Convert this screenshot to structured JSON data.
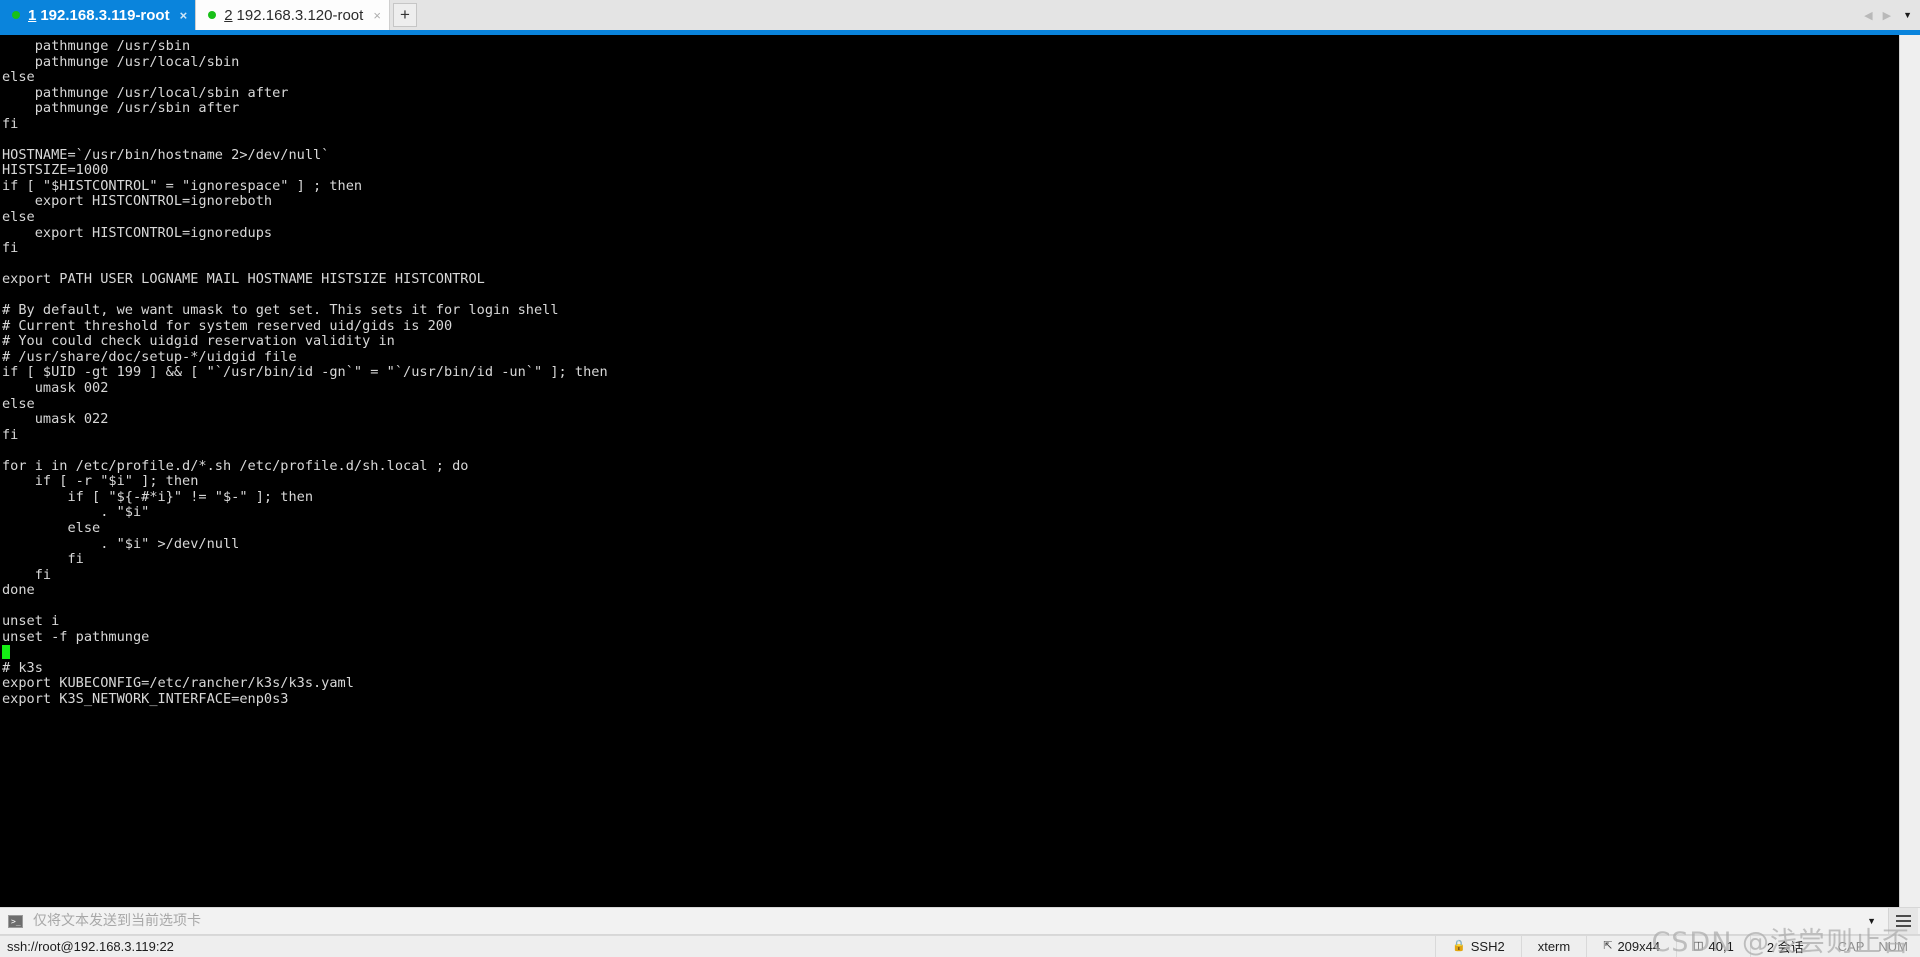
{
  "window": {
    "accent_color": "#0a84dc",
    "tab_active_bg": "#0a84dc",
    "terminal_bg": "#000000",
    "terminal_fg": "#d8d8d8",
    "cursor_color": "#14f014"
  },
  "tabbar": {
    "tabs": [
      {
        "number": "1",
        "label": "192.168.3.119-root",
        "close": "×",
        "status_dot": "connected-dot",
        "active": true
      },
      {
        "number": "2",
        "label": "192.168.3.120-root",
        "close": "×",
        "status_dot": "connected-dot",
        "active": false
      }
    ],
    "new_tab_label": "+",
    "prev_arrow": "◀",
    "next_arrow": "▶",
    "list_caret": "▼"
  },
  "terminal": {
    "lines": [
      "    pathmunge /usr/sbin",
      "    pathmunge /usr/local/sbin",
      "else",
      "    pathmunge /usr/local/sbin after",
      "    pathmunge /usr/sbin after",
      "fi",
      "",
      "HOSTNAME=`/usr/bin/hostname 2>/dev/null`",
      "HISTSIZE=1000",
      "if [ \"$HISTCONTROL\" = \"ignorespace\" ] ; then",
      "    export HISTCONTROL=ignoreboth",
      "else",
      "    export HISTCONTROL=ignoredups",
      "fi",
      "",
      "export PATH USER LOGNAME MAIL HOSTNAME HISTSIZE HISTCONTROL",
      "",
      "# By default, we want umask to get set. This sets it for login shell",
      "# Current threshold for system reserved uid/gids is 200",
      "# You could check uidgid reservation validity in",
      "# /usr/share/doc/setup-*/uidgid file",
      "if [ $UID -gt 199 ] && [ \"`/usr/bin/id -gn`\" = \"`/usr/bin/id -un`\" ]; then",
      "    umask 002",
      "else",
      "    umask 022",
      "fi",
      "",
      "for i in /etc/profile.d/*.sh /etc/profile.d/sh.local ; do",
      "    if [ -r \"$i\" ]; then",
      "        if [ \"${-#*i}\" != \"$-\" ]; then",
      "            . \"$i\"",
      "        else",
      "            . \"$i\" >/dev/null",
      "        fi",
      "    fi",
      "done",
      "",
      "unset i",
      "unset -f pathmunge"
    ],
    "cursor_line": "",
    "trailing_lines": [
      "# k3s",
      "export KUBECONFIG=/etc/rancher/k3s/k3s.yaml",
      "export K3S_NETWORK_INTERFACE=enp0s3"
    ]
  },
  "commandbar": {
    "icon": "terminal-prompt-icon",
    "icon_glyph": ">_",
    "placeholder": "仅将文本发送到当前选项卡",
    "value": "",
    "caret": "▼",
    "menu": "hamburger-menu-icon"
  },
  "statusbar": {
    "connection": "ssh://root@192.168.3.119:22",
    "lock_icon": "lock-icon",
    "lock_glyph": "🔒",
    "protocol": "SSH2",
    "emulation": "xterm",
    "size_icon": "resize-icon",
    "size": "209x44",
    "position_icon": "cursor-position-icon",
    "position": "40,1",
    "sessions": "2 会话",
    "caps": "CAP",
    "num": "NUM"
  },
  "watermark": {
    "text": "CSDN @浅尝则止否",
    "arrow": "⬇"
  }
}
